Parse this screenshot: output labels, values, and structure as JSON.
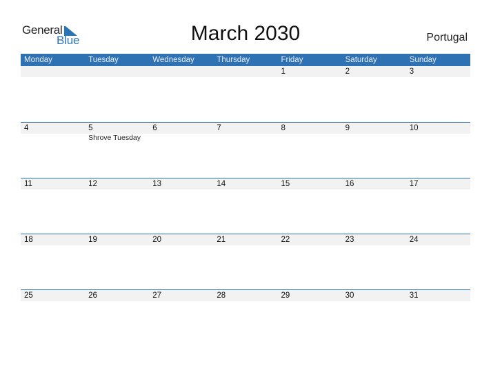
{
  "logo": {
    "word1": "General",
    "word2": "Blue",
    "icon": "triangle-flag-icon"
  },
  "title": "March 2030",
  "country": "Portugal",
  "colors": {
    "accent": "#2e72b3",
    "logo_blue": "#2a74b8",
    "date_strip": "#f2f2f2"
  },
  "weekdays": [
    "Monday",
    "Tuesday",
    "Wednesday",
    "Thursday",
    "Friday",
    "Saturday",
    "Sunday"
  ],
  "weeks": [
    {
      "days": [
        {
          "num": "",
          "holiday": ""
        },
        {
          "num": "",
          "holiday": ""
        },
        {
          "num": "",
          "holiday": ""
        },
        {
          "num": "",
          "holiday": ""
        },
        {
          "num": "1",
          "holiday": ""
        },
        {
          "num": "2",
          "holiday": ""
        },
        {
          "num": "3",
          "holiday": ""
        }
      ]
    },
    {
      "days": [
        {
          "num": "4",
          "holiday": ""
        },
        {
          "num": "5",
          "holiday": "Shrove Tuesday"
        },
        {
          "num": "6",
          "holiday": ""
        },
        {
          "num": "7",
          "holiday": ""
        },
        {
          "num": "8",
          "holiday": ""
        },
        {
          "num": "9",
          "holiday": ""
        },
        {
          "num": "10",
          "holiday": ""
        }
      ]
    },
    {
      "days": [
        {
          "num": "11",
          "holiday": ""
        },
        {
          "num": "12",
          "holiday": ""
        },
        {
          "num": "13",
          "holiday": ""
        },
        {
          "num": "14",
          "holiday": ""
        },
        {
          "num": "15",
          "holiday": ""
        },
        {
          "num": "16",
          "holiday": ""
        },
        {
          "num": "17",
          "holiday": ""
        }
      ]
    },
    {
      "days": [
        {
          "num": "18",
          "holiday": ""
        },
        {
          "num": "19",
          "holiday": ""
        },
        {
          "num": "20",
          "holiday": ""
        },
        {
          "num": "21",
          "holiday": ""
        },
        {
          "num": "22",
          "holiday": ""
        },
        {
          "num": "23",
          "holiday": ""
        },
        {
          "num": "24",
          "holiday": ""
        }
      ]
    },
    {
      "days": [
        {
          "num": "25",
          "holiday": ""
        },
        {
          "num": "26",
          "holiday": ""
        },
        {
          "num": "27",
          "holiday": ""
        },
        {
          "num": "28",
          "holiday": ""
        },
        {
          "num": "29",
          "holiday": ""
        },
        {
          "num": "30",
          "holiday": ""
        },
        {
          "num": "31",
          "holiday": ""
        }
      ]
    }
  ]
}
